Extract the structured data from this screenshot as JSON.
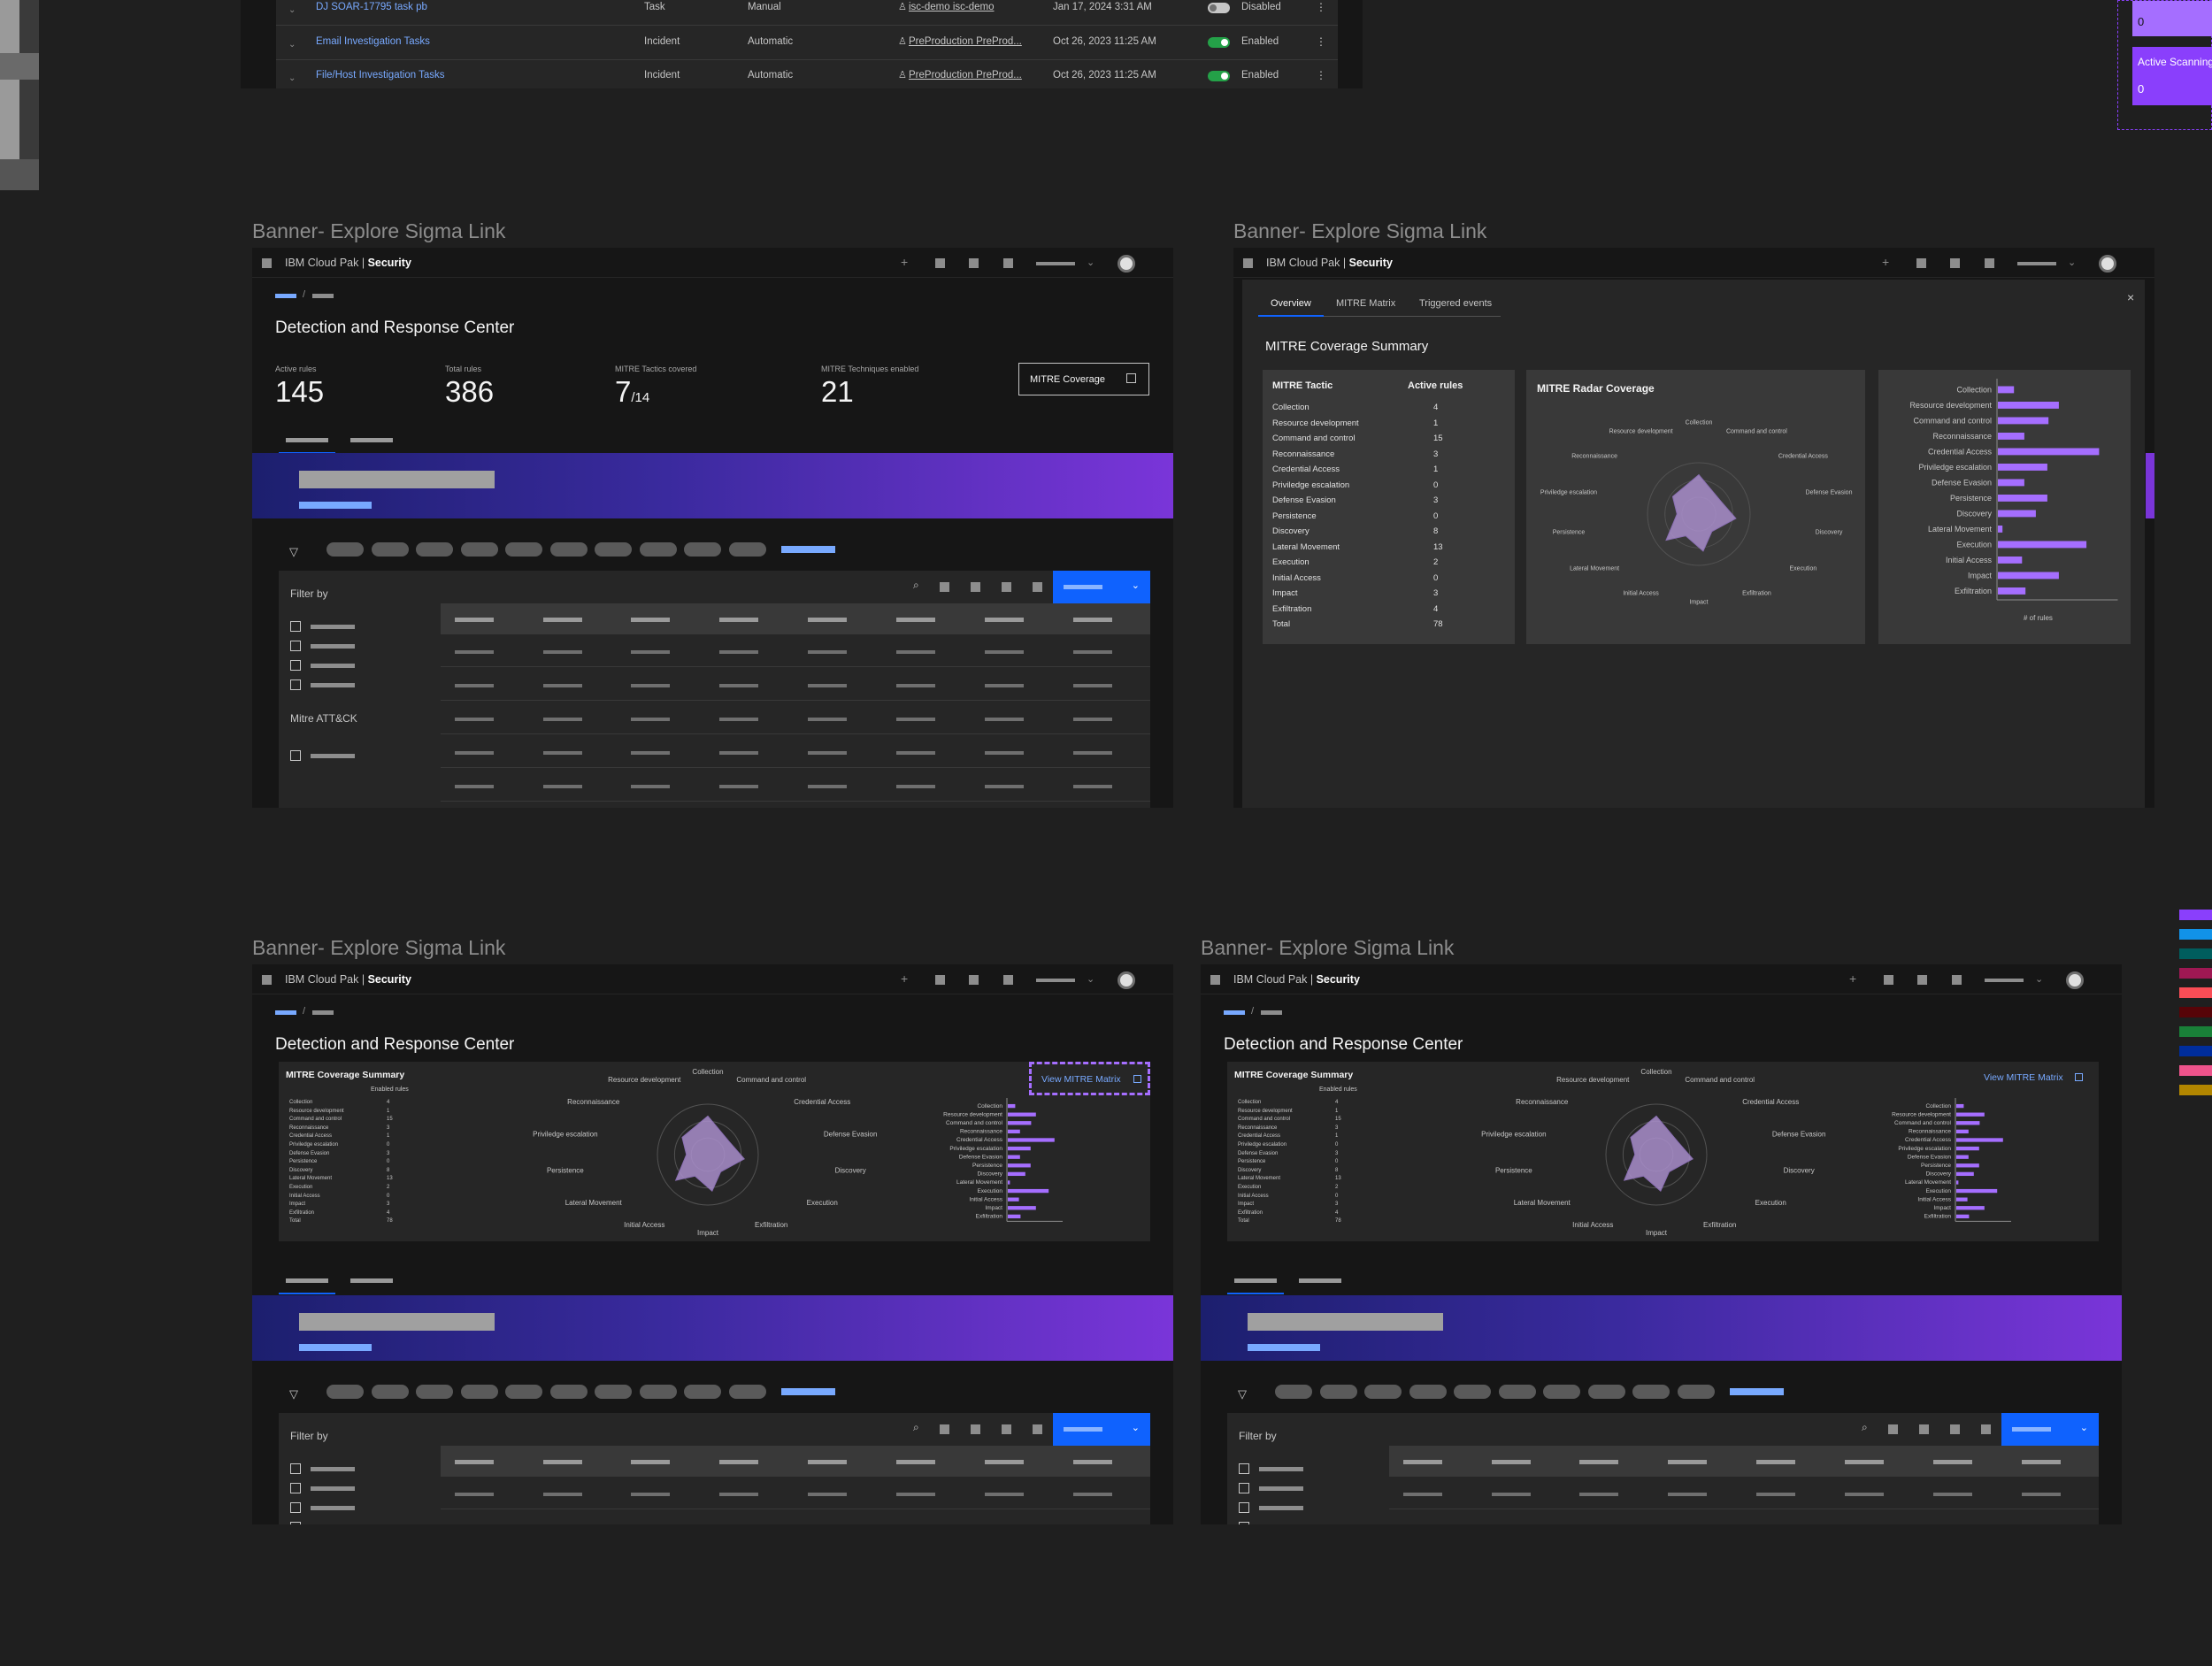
{
  "top_table": {
    "rows": [
      {
        "name": "DJ SOAR-17795 task pb",
        "type": "Task",
        "mode": "Manual",
        "owner": "isc-demo isc-demo",
        "date": "Jan 17, 2024 3:31 AM",
        "status": "Disabled"
      },
      {
        "name": "Email Investigation Tasks",
        "type": "Incident",
        "mode": "Automatic",
        "owner": "PreProduction PreProd...",
        "date": "Oct 26, 2023 11:25 AM",
        "status": "Enabled"
      },
      {
        "name": "File/Host Investigation Tasks",
        "type": "Incident",
        "mode": "Automatic",
        "owner": "PreProduction PreProd...",
        "date": "Oct 26, 2023 11:25 AM",
        "status": "Enabled"
      }
    ]
  },
  "side_cards": {
    "value1": "0",
    "label2": "Active Scanning",
    "value2": "0"
  },
  "frame_label": "Banner- Explore Sigma Link",
  "shell": {
    "product": "IBM Cloud Pak | ",
    "product_bold": "Security"
  },
  "page": {
    "title": "Detection and Response Center",
    "breadcrumb_sep": "/"
  },
  "kpis": [
    {
      "label": "Active rules",
      "value": "145"
    },
    {
      "label": "Total rules",
      "value": "386"
    },
    {
      "label": "MITRE Tactics covered",
      "value": "7",
      "suffix": "/14"
    },
    {
      "label": "MITRE Techniques enabled",
      "value": "21"
    }
  ],
  "mitre_button": "MITRE Coverage",
  "filter": {
    "title": "Filter by",
    "section": "Mitre ATT&CK"
  },
  "tabs": [
    "Overview",
    "MITRE Matrix",
    "Triggered events"
  ],
  "close_glyph": "×",
  "coverage": {
    "title": "MITRE Coverage Summary",
    "col_tactic": "MITRE Tactic",
    "col_rules": "Active rules",
    "col_enabled": "Enabled rules",
    "radar_title": "MITRE Radar Coverage",
    "bar_axis": "# of rules",
    "view_link": "View MITRE Matrix",
    "tactics": [
      {
        "name": "Collection",
        "v": "4"
      },
      {
        "name": "Resource development",
        "v": "1"
      },
      {
        "name": "Command and control",
        "v": "15"
      },
      {
        "name": "Reconnaissance",
        "v": "3"
      },
      {
        "name": "Credential Access",
        "v": "1"
      },
      {
        "name": "Priviledge escalation",
        "v": "0"
      },
      {
        "name": "Defense Evasion",
        "v": "3"
      },
      {
        "name": "Persistence",
        "v": "0"
      },
      {
        "name": "Discovery",
        "v": "8"
      },
      {
        "name": "Lateral Movement",
        "v": "13"
      },
      {
        "name": "Execution",
        "v": "2"
      },
      {
        "name": "Initial Access",
        "v": "0"
      },
      {
        "name": "Impact",
        "v": "3"
      },
      {
        "name": "Exfiltration",
        "v": "4"
      },
      {
        "name": "Total",
        "v": "78"
      }
    ],
    "radar_labels": [
      "Collection",
      "Command and control",
      "Credential Access",
      "Defense Evasion",
      "Discovery",
      "Execution",
      "Exfiltration",
      "Impact",
      "Initial Access",
      "Lateral Movement",
      "Persistence",
      "Priviledge escalation",
      "Reconnaissance",
      "Resource development"
    ],
    "bar_labels": [
      "Collection",
      "Resource development",
      "Command and control",
      "Reconnaissance",
      "Credential Access",
      "Priviledge escalation",
      "Defense Evasion",
      "Persistence",
      "Discovery",
      "Lateral Movement",
      "Execution",
      "Initial Access",
      "Impact",
      "Exfiltration"
    ],
    "bar_values": [
      0.14,
      0.53,
      0.44,
      0.23,
      0.88,
      0.43,
      0.23,
      0.43,
      0.33,
      0.04,
      0.77,
      0.21,
      0.53,
      0.24
    ]
  },
  "swatches": [
    "#8a3ffc",
    "#1192e8",
    "#005d5d",
    "#9f1853",
    "#fa4d56",
    "#570408",
    "#198038",
    "#002d9c",
    "#ee538b",
    "#b28600"
  ]
}
